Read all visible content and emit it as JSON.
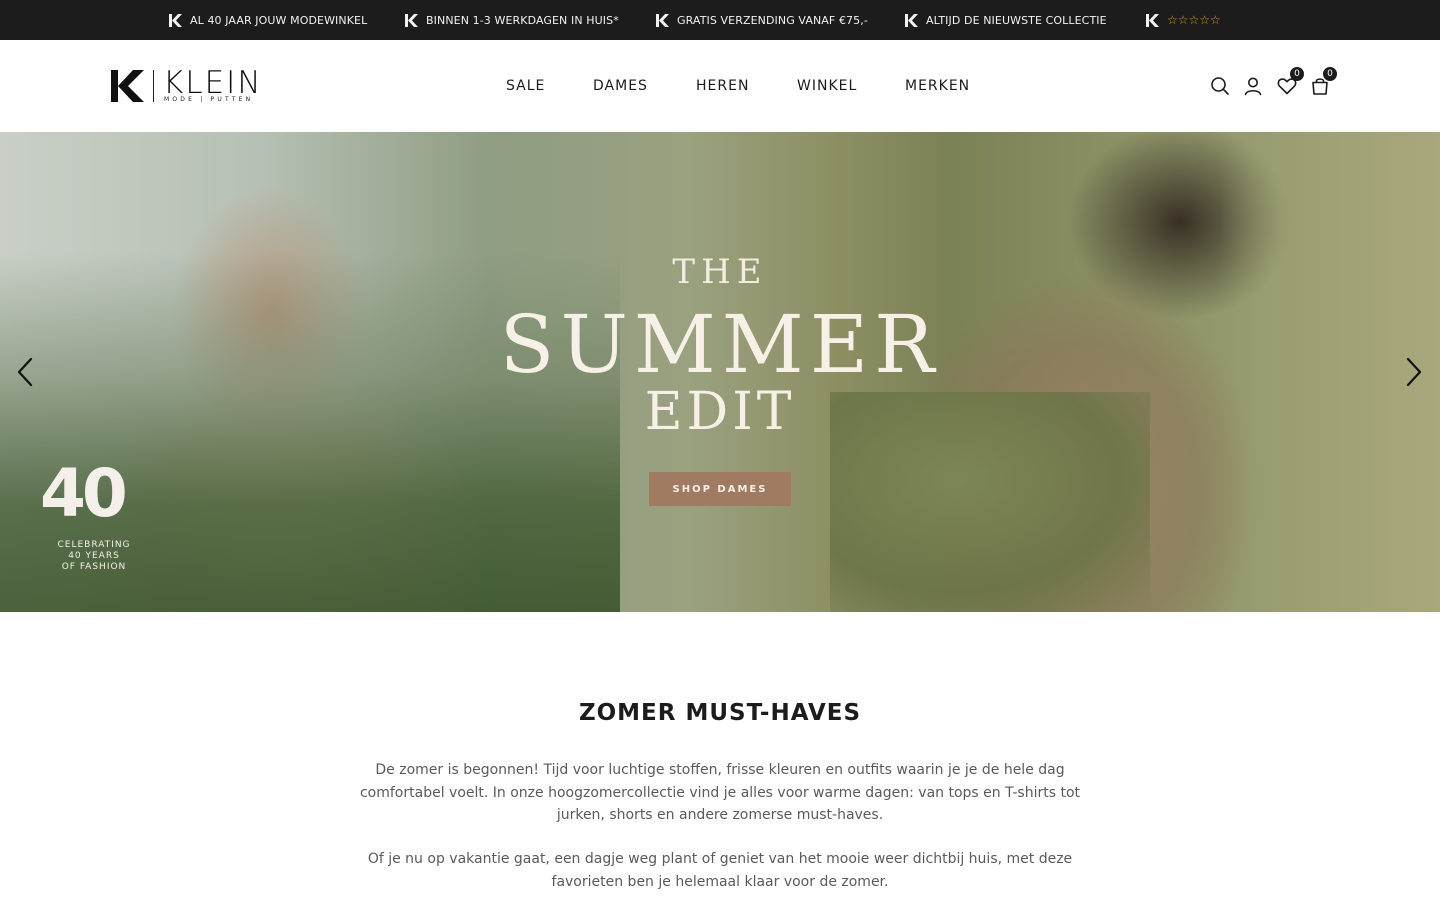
{
  "topbar": {
    "usps": [
      "AL 40 JAAR JOUW MODEWINKEL",
      "BINNEN 1-3 WERKDAGEN IN HUIS*",
      "GRATIS VERZENDING VANAF €75,-",
      "ALTIJD DE NIEUWSTE COLLECTIE"
    ],
    "rating_stars": "☆☆☆☆☆",
    "stars_color": "#e09a3a"
  },
  "header": {
    "logo": {
      "name": "KLEIN",
      "tagline": "MODE | PUTTEN"
    },
    "nav": [
      "SALE",
      "DAMES",
      "HEREN",
      "WINKEL",
      "MERKEN"
    ],
    "icons": [
      "search-icon",
      "account-icon",
      "wishlist-icon",
      "cart-icon"
    ],
    "wishlist_count": "0",
    "cart_count": "0"
  },
  "hero": {
    "line1": "THE",
    "line2": "SUMMER",
    "line3": "EDIT",
    "cta": "SHOP DAMES",
    "badge_number": "40",
    "badge_caption": [
      "CELEBRATING",
      "40 YEARS",
      "OF FASHION"
    ],
    "cta_color": "#a07b62"
  },
  "content": {
    "title": "ZOMER MUST-HAVES",
    "paragraph1": "De zomer is begonnen! Tijd voor luchtige stoffen, frisse kleuren en outfits waarin je je de hele dag comfortabel voelt. In onze hoogzomercollectie vind je alles voor warme dagen: van tops en T-shirts tot jurken, shorts en andere zomerse must-haves.",
    "paragraph2": "Of je nu op vakantie gaat, een dagje weg plant of geniet van het mooie weer dichtbij huis, met deze favorieten ben je helemaal klaar voor de zomer."
  }
}
